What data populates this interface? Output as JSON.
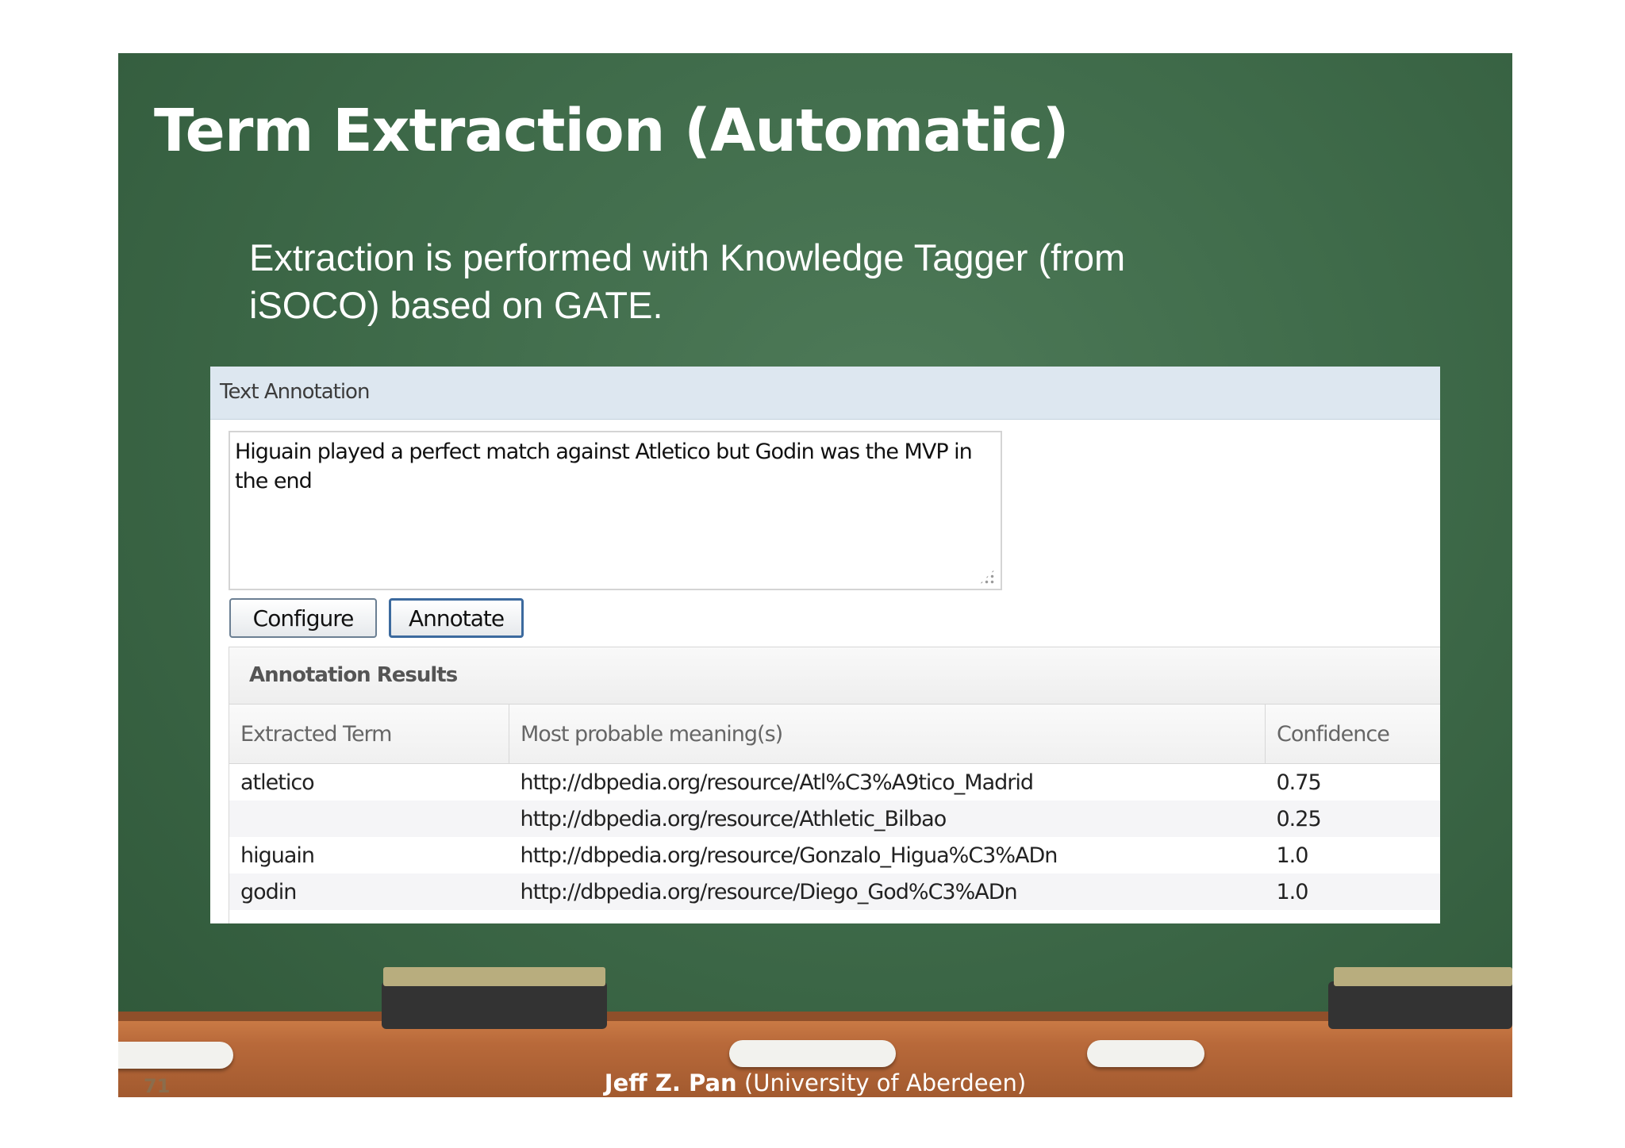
{
  "slide": {
    "title": "Term Extraction (Automatic)",
    "body_line1": "Extraction is performed with Knowledge Tagger (from",
    "body_line2": "iSOCO) based on GATE.",
    "slide_number": "71",
    "footer_author": "Jeff Z. Pan",
    "footer_affiliation": " (University of  Aberdeen)"
  },
  "panel": {
    "title": "Text Annotation",
    "input_text": "Higuain played a perfect match against Atletico but Godin was the MVP in the end",
    "configure_label": "Configure",
    "annotate_label": "Annotate",
    "results_title": "Annotation Results",
    "columns": [
      "Extracted Term",
      "Most probable meaning(s)",
      "Confidence"
    ],
    "rows": [
      {
        "term": "atletico",
        "meaning": "http://dbpedia.org/resource/Atl%C3%A9tico_Madrid",
        "confidence": "0.75"
      },
      {
        "term": "",
        "meaning": "http://dbpedia.org/resource/Athletic_Bilbao",
        "confidence": "0.25"
      },
      {
        "term": "higuain",
        "meaning": "http://dbpedia.org/resource/Gonzalo_Higua%C3%ADn",
        "confidence": "1.0"
      },
      {
        "term": "godin",
        "meaning": "http://dbpedia.org/resource/Diego_God%C3%ADn",
        "confidence": "1.0"
      }
    ]
  },
  "colors": {
    "chalkboard": "#3f6b4a",
    "panel_header": "#dde7f0",
    "ledge": "#b8693a"
  }
}
